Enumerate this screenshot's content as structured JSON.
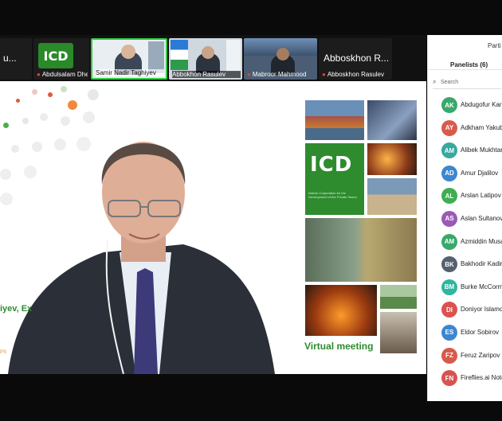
{
  "filmstrip": {
    "tiles": [
      {
        "name": "",
        "big_name": "u..."
      },
      {
        "name": "Abdulsalam Dheyab",
        "logo": "ICD"
      },
      {
        "name": "Samir Nadir Taghiyev"
      },
      {
        "name": "Abbokhon Rasulev"
      },
      {
        "name": "Mabroor Mahmood"
      },
      {
        "name": "Abboskhon Rasulev",
        "big_name": "Abboskhon R..."
      }
    ]
  },
  "slide": {
    "logo_text": "ICD",
    "logo_subtitle": "Islamic Corporation for the Development of the Private Sector",
    "virtual_label": "Virtual meeting",
    "speaker_partial": "iyev, Ex",
    "footer_partial": "PS"
  },
  "panel": {
    "title": "Parti",
    "panelists_label": "Panelists (6)",
    "search_placeholder": "Search",
    "members": [
      {
        "initials": "AK",
        "name": "Abdugofur Karin",
        "color": "#3aa86b"
      },
      {
        "initials": "AY",
        "name": "Adkham Yakubo",
        "color": "#d95a4a"
      },
      {
        "initials": "AM",
        "name": "Alibek Mukhtaro",
        "color": "#38a8a0"
      },
      {
        "initials": "AD",
        "name": "Amur Djalilov",
        "color": "#3d86d0"
      },
      {
        "initials": "AL",
        "name": "Arslan Latipov",
        "color": "#3fae52"
      },
      {
        "initials": "AS",
        "name": "Aslan Sultanov",
        "color": "#9b59b6"
      },
      {
        "initials": "AM",
        "name": "Azmiddin Musa",
        "color": "#3aa86b"
      },
      {
        "initials": "BK",
        "name": "Bakhodir Kadiro",
        "color": "#556070"
      },
      {
        "initials": "BM",
        "name": "Burke McCorma",
        "color": "#2fb5a0"
      },
      {
        "initials": "DI",
        "name": "Doniyor Islamov",
        "color": "#d9534f"
      },
      {
        "initials": "ES",
        "name": "Eldor Sobirov",
        "color": "#3d86d0"
      },
      {
        "initials": "FZ",
        "name": "Feruz Zaripov",
        "color": "#d95a4a"
      },
      {
        "initials": "FN",
        "name": "Fireflies.ai Note",
        "color": "#d9534f"
      }
    ]
  }
}
